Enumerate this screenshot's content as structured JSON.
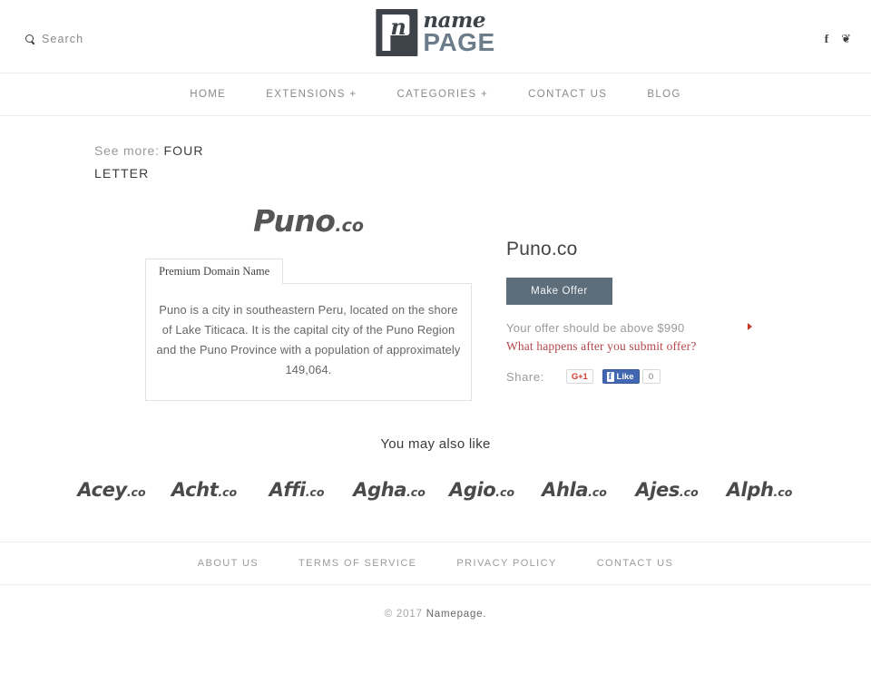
{
  "header": {
    "search_label": "Search",
    "search_icon": "search-icon",
    "logo": {
      "mark_letter": "n",
      "name_text": "name",
      "page_text": "PAGE"
    },
    "social": {
      "facebook": "f",
      "twitter": "❦"
    }
  },
  "nav": {
    "items": [
      {
        "label": "HOME"
      },
      {
        "label": "EXTENSIONS +"
      },
      {
        "label": "CATEGORIES +"
      },
      {
        "label": "CONTACT US"
      },
      {
        "label": "BLOG"
      }
    ]
  },
  "breadcrumb": {
    "prefix": "See more:",
    "category": "FOUR LETTER"
  },
  "hero": {
    "name": "Puno",
    "tld": ".co"
  },
  "description": {
    "tab_label": "Premium Domain Name",
    "text": "Puno is a city in southeastern Peru, located on the shore of Lake Titicaca. It is the capital city of the Puno Region and the Puno Province with a population of approximately 149,064."
  },
  "offer": {
    "domain_title": "Puno.co",
    "button_label": "Make Offer",
    "hint": "Your offer should be above $990",
    "min_price": "$990",
    "help_link": "What happens after you submit offer?",
    "share_label": "Share:",
    "gplus_label": "G+1",
    "fb_like_label": "Like",
    "fb_f": "f",
    "fb_count": "0",
    "accent_red": "#b4484c",
    "button_color": "#5d6d7a"
  },
  "also_like": {
    "title": "You may also like",
    "items": [
      {
        "name": "Acey",
        "tld": ".co"
      },
      {
        "name": "Acht",
        "tld": ".co"
      },
      {
        "name": "Affi",
        "tld": ".co"
      },
      {
        "name": "Agha",
        "tld": ".co"
      },
      {
        "name": "Agio",
        "tld": ".co"
      },
      {
        "name": "Ahla",
        "tld": ".co"
      },
      {
        "name": "Ajes",
        "tld": ".co"
      },
      {
        "name": "Alph",
        "tld": ".co"
      }
    ]
  },
  "footer": {
    "links": [
      {
        "label": "ABOUT US"
      },
      {
        "label": "TERMS OF SERVICE"
      },
      {
        "label": "PRIVACY POLICY"
      },
      {
        "label": "CONTACT US"
      }
    ],
    "copyright_year": "© 2017",
    "copyright_name": "Namepage."
  }
}
